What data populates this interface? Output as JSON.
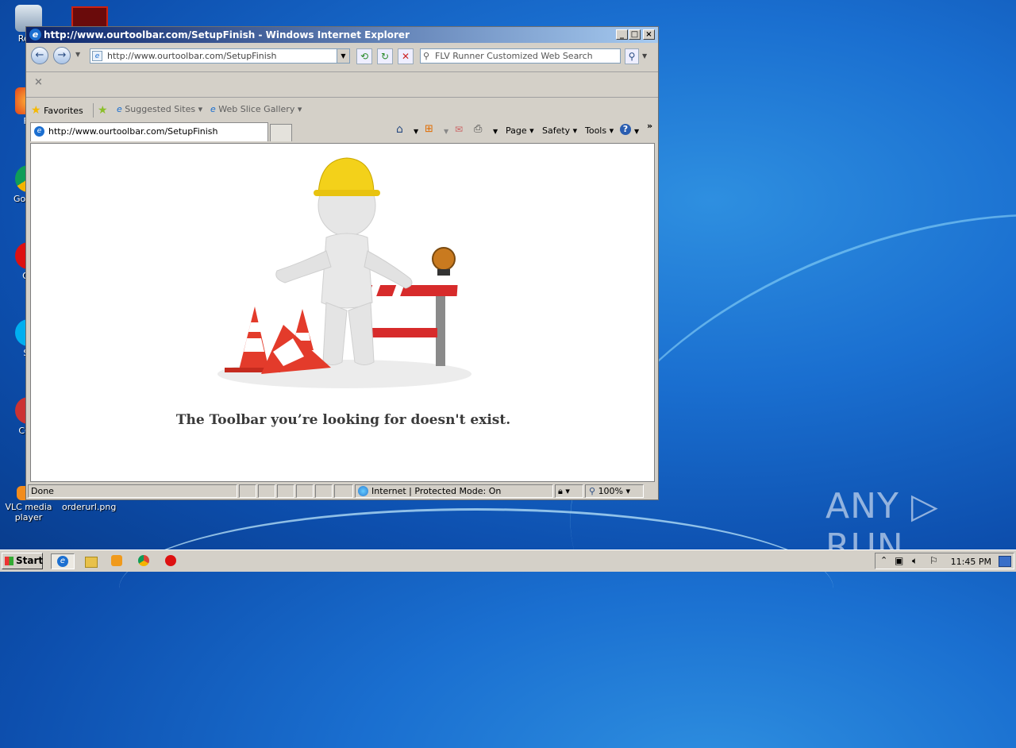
{
  "desktop": {
    "icons": [
      {
        "label": "Recy"
      },
      {
        "label": "Fir"
      },
      {
        "label": "Go Chr"
      },
      {
        "label": "Op"
      },
      {
        "label": "Sk"
      },
      {
        "label": "CCle"
      },
      {
        "label": "VLC media player"
      },
      {
        "label": "orderurl.png"
      }
    ],
    "watermark": "ANY ▷ RUN"
  },
  "window": {
    "title": "http://www.ourtoolbar.com/SetupFinish - Windows Internet Explorer",
    "address_value": "http://www.ourtoolbar.com/SetupFinish",
    "search_placeholder": "FLV Runner Customized Web Search",
    "favorites_label": "Favorites",
    "suggested_sites_label": "Suggested Sites",
    "web_slice_label": "Web Slice Gallery",
    "tab_title": "http://www.ourtoolbar.com/SetupFinish",
    "commands": {
      "page": "Page",
      "safety": "Safety",
      "tools": "Tools"
    },
    "page_message": "The Toolbar you’re looking for doesn't exist.",
    "status": {
      "text": "Done",
      "zone": "Internet | Protected Mode: On",
      "zoom": "100%"
    }
  },
  "taskbar": {
    "start_label": "Start",
    "clock": "11:45 PM"
  }
}
